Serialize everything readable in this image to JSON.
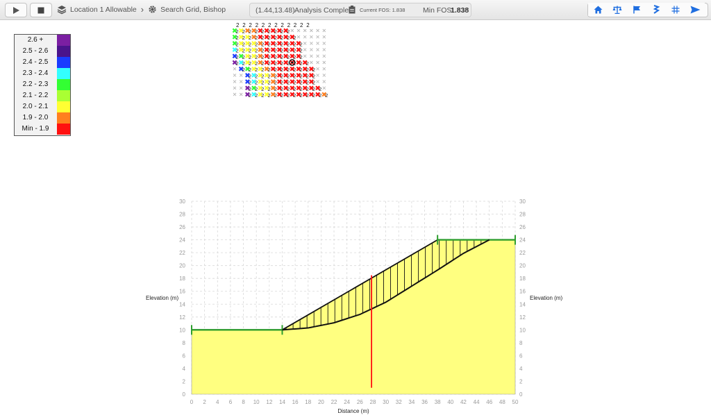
{
  "toolbar": {
    "breadcrumb_location": "Location 1 Allowable",
    "breadcrumb_method": "Search Grid, Bishop",
    "status_coords": "(1.44,13.48)",
    "status_text": "Analysis Complete",
    "current_fos_label": "Current FOS: 1.838",
    "min_fos_label": "Min FOS:",
    "min_fos_value": "1.838",
    "icons": [
      "play-icon",
      "stop-icon",
      "layers-icon",
      "gear-icon",
      "clipboard-icon",
      "home-icon",
      "scale-icon",
      "flag-icon",
      "anchor-icon",
      "grid-icon",
      "send-icon"
    ],
    "accent_color": "#1f6ee0"
  },
  "legend": [
    {
      "label": "2.6 +",
      "color": "#7b1fa2"
    },
    {
      "label": "2.5 - 2.6",
      "color": "#4a148c"
    },
    {
      "label": "2.4 - 2.5",
      "color": "#1a3cff"
    },
    {
      "label": "2.3 - 2.4",
      "color": "#33ffff"
    },
    {
      "label": "2.2 - 2.3",
      "color": "#33ff33"
    },
    {
      "label": "2.1 - 2.2",
      "color": "#aaff33"
    },
    {
      "label": "2.0 - 2.1",
      "color": "#ffff33"
    },
    {
      "label": "1.9 - 2.0",
      "color": "#ff7f1f"
    },
    {
      "label": "Min - 1.9",
      "color": "#ff1010"
    }
  ],
  "search_grid": {
    "top_labels": [
      "2",
      "2",
      "2",
      "2",
      "2",
      "2",
      "2",
      "2",
      "2",
      "2",
      "2",
      "2"
    ],
    "rows": [
      "gyoorrrrr......",
      "gyyorrrrrr.....",
      "gyyyorrrrrr....",
      "cyyyorrrrrr....",
      "bgyyorrrrrr....",
      "pcyyorrrrrrr...",
      ".bgyyorrrrrrr..",
      "..bcyyorrrrrr..",
      "..bcyyorrrrrr..",
      "..pgyyorrrrrrr.",
      "..pcyyorrrrrrro"
    ],
    "minimum_label": "2",
    "colors": {
      "p": "#7b1fa2",
      "b": "#1a3cff",
      "c": "#33ffff",
      "g": "#33ff33",
      "y": "#ffff33",
      "o": "#ff7f1f",
      "r": "#ff1010"
    }
  },
  "chart_data": {
    "type": "line",
    "xlabel": "Distance (m)",
    "ylabel": "Elevation (m)",
    "xlim": [
      0,
      50
    ],
    "ylim": [
      0,
      30
    ],
    "x_ticks": [
      0,
      2,
      4,
      6,
      8,
      10,
      12,
      14,
      16,
      18,
      20,
      22,
      24,
      26,
      28,
      30,
      32,
      34,
      36,
      38,
      40,
      42,
      44,
      46,
      48,
      50
    ],
    "y_ticks": [
      0,
      2,
      4,
      6,
      8,
      10,
      12,
      14,
      16,
      18,
      20,
      22,
      24,
      26,
      28,
      30
    ],
    "grid": true,
    "slope_profile": {
      "x": [
        0,
        14,
        38,
        50
      ],
      "y": [
        10,
        10,
        24,
        24
      ],
      "color": "#2e9e2e"
    },
    "soil_fill_color": "#ffff80",
    "slip_surface": {
      "x": [
        14,
        18,
        22,
        26,
        30,
        34,
        38,
        42,
        46
      ],
      "y": [
        10,
        10.3,
        11.1,
        12.4,
        14.3,
        16.8,
        19.3,
        21.9,
        24
      ],
      "color": "#111111"
    },
    "water_table_marker": {
      "x": [
        27.8,
        27.8
      ],
      "y": [
        1,
        18.5
      ],
      "color": "#ff1010"
    },
    "slices_from": 14.6,
    "slices_to": 45.8,
    "slice_count": 30
  }
}
